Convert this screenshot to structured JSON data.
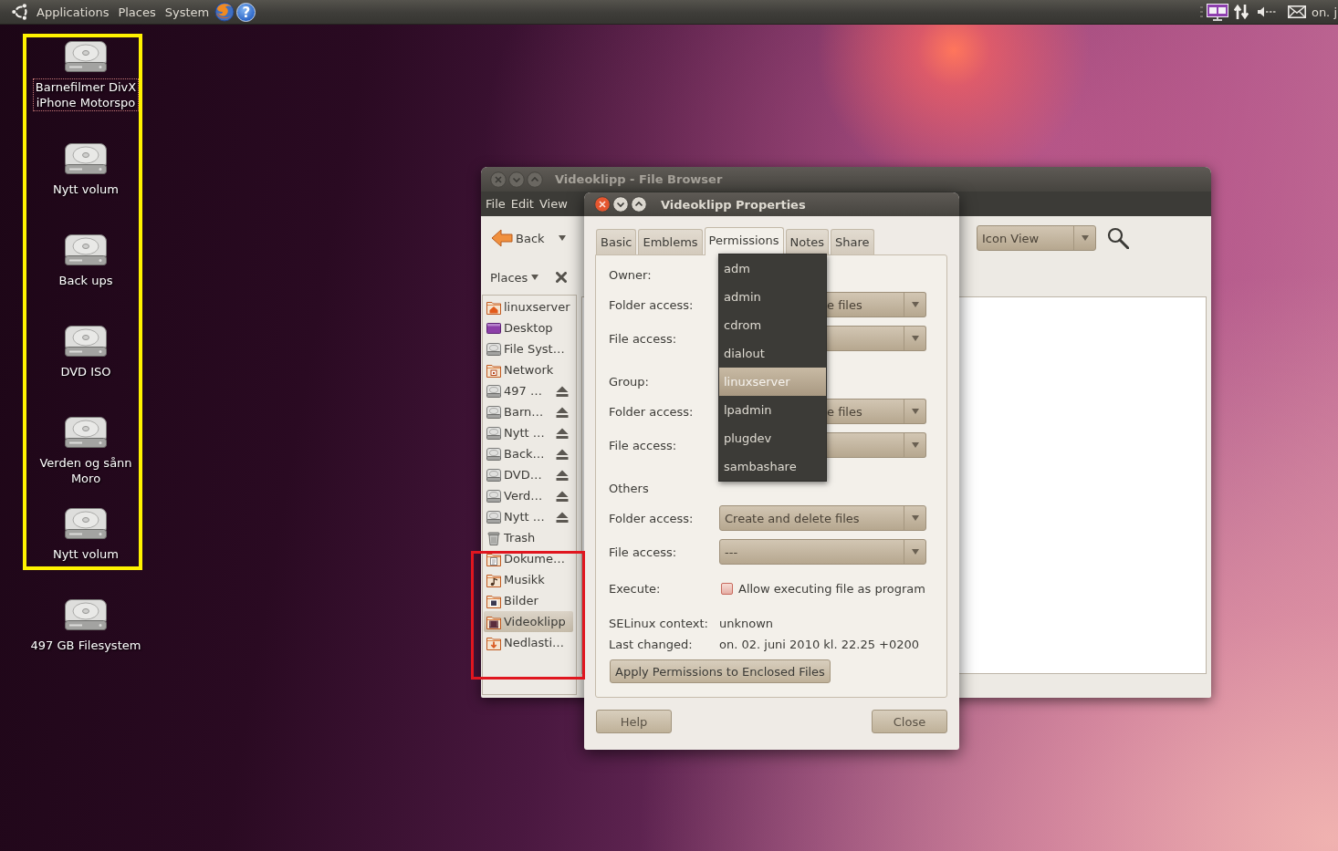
{
  "top_panel": {
    "menus": [
      "Applications",
      "Places",
      "System"
    ],
    "help_glyph": "?",
    "clock": "on. j"
  },
  "desktop_icons": [
    {
      "label": "Barnefilmer DivX\niPhone Motorspo",
      "selected": true
    },
    {
      "label": "Nytt volum",
      "selected": false
    },
    {
      "label": "Back ups",
      "selected": false
    },
    {
      "label": "DVD ISO",
      "selected": false
    },
    {
      "label": "Verden og sånn\nMoro",
      "selected": false
    },
    {
      "label": "Nytt volum",
      "selected": false
    },
    {
      "label": "497 GB Filesystem",
      "selected": false
    }
  ],
  "highlight_frames": [
    {
      "color": "#fff200"
    },
    {
      "color": "#e0161f"
    }
  ],
  "file_browser": {
    "title": "Videoklipp - File Browser",
    "active": false,
    "menus": [
      "File",
      "Edit",
      "View"
    ],
    "back": "Back",
    "places_header": "Places",
    "view_mode": "Icon View",
    "places": [
      {
        "label": "linuxserver",
        "kind": "home",
        "ejectable": false,
        "selected": false
      },
      {
        "label": "Desktop",
        "kind": "desktop",
        "ejectable": false,
        "selected": false
      },
      {
        "label": "File Syst…",
        "kind": "drive",
        "ejectable": false,
        "selected": false
      },
      {
        "label": "Network",
        "kind": "network",
        "ejectable": false,
        "selected": false
      },
      {
        "label": "497 …",
        "kind": "drive",
        "ejectable": true,
        "selected": false
      },
      {
        "label": "Barn…",
        "kind": "drive",
        "ejectable": true,
        "selected": false
      },
      {
        "label": "Nytt …",
        "kind": "drive",
        "ejectable": true,
        "selected": false
      },
      {
        "label": "Back…",
        "kind": "drive",
        "ejectable": true,
        "selected": false
      },
      {
        "label": "DVD…",
        "kind": "drive",
        "ejectable": true,
        "selected": false
      },
      {
        "label": "Verd…",
        "kind": "drive",
        "ejectable": true,
        "selected": false
      },
      {
        "label": "Nytt …",
        "kind": "drive",
        "ejectable": true,
        "selected": false
      },
      {
        "label": "Trash",
        "kind": "trash",
        "ejectable": false,
        "selected": false
      },
      {
        "label": "Dokume…",
        "kind": "documents",
        "ejectable": false,
        "selected": false
      },
      {
        "label": "Musikk",
        "kind": "music",
        "ejectable": false,
        "selected": false
      },
      {
        "label": "Bilder",
        "kind": "pictures",
        "ejectable": false,
        "selected": false
      },
      {
        "label": "Videoklipp",
        "kind": "videos",
        "ejectable": false,
        "selected": true
      },
      {
        "label": "Nedlasti…",
        "kind": "downloads",
        "ejectable": false,
        "selected": false
      }
    ]
  },
  "properties": {
    "title": "Videoklipp Properties",
    "active": true,
    "tabs": [
      {
        "label": "Basic",
        "selected": false
      },
      {
        "label": "Emblems",
        "selected": false
      },
      {
        "label": "Permissions",
        "selected": true
      },
      {
        "label": "Notes",
        "selected": false
      },
      {
        "label": "Share",
        "selected": false
      }
    ],
    "rows": [
      {
        "kind": "heading",
        "label": "Owner:"
      },
      {
        "kind": "combo",
        "label": "Folder access:",
        "value": "e files"
      },
      {
        "kind": "combo",
        "label": "File access:"
      },
      {
        "kind": "heading",
        "label": "Group:"
      },
      {
        "kind": "combo",
        "label": "Folder access:",
        "value": "e files"
      },
      {
        "kind": "combo",
        "label": "File access:"
      },
      {
        "kind": "heading",
        "label": "Others"
      },
      {
        "kind": "combo",
        "label": "Folder access:",
        "value": "Create and delete files"
      },
      {
        "kind": "combo",
        "label": "File access:",
        "value": "---"
      },
      {
        "kind": "checkbox",
        "label": "Execute:",
        "text": "Allow executing file as program",
        "checked": false
      },
      {
        "kind": "info",
        "label": "SELinux context:",
        "value": "unknown"
      },
      {
        "kind": "info",
        "label": "Last changed:",
        "value": "on. 02. juni 2010 kl. 22.25 +0200"
      }
    ],
    "apply_button": "Apply Permissions to Enclosed Files",
    "buttons": [
      "Help",
      "Close"
    ],
    "group_menu": [
      {
        "label": "adm",
        "selected": false
      },
      {
        "label": "admin",
        "selected": false
      },
      {
        "label": "cdrom",
        "selected": false
      },
      {
        "label": "dialout",
        "selected": false
      },
      {
        "label": "linuxserver",
        "selected": true
      },
      {
        "label": "lpadmin",
        "selected": false
      },
      {
        "label": "plugdev",
        "selected": false
      },
      {
        "label": "sambashare",
        "selected": false
      }
    ]
  }
}
